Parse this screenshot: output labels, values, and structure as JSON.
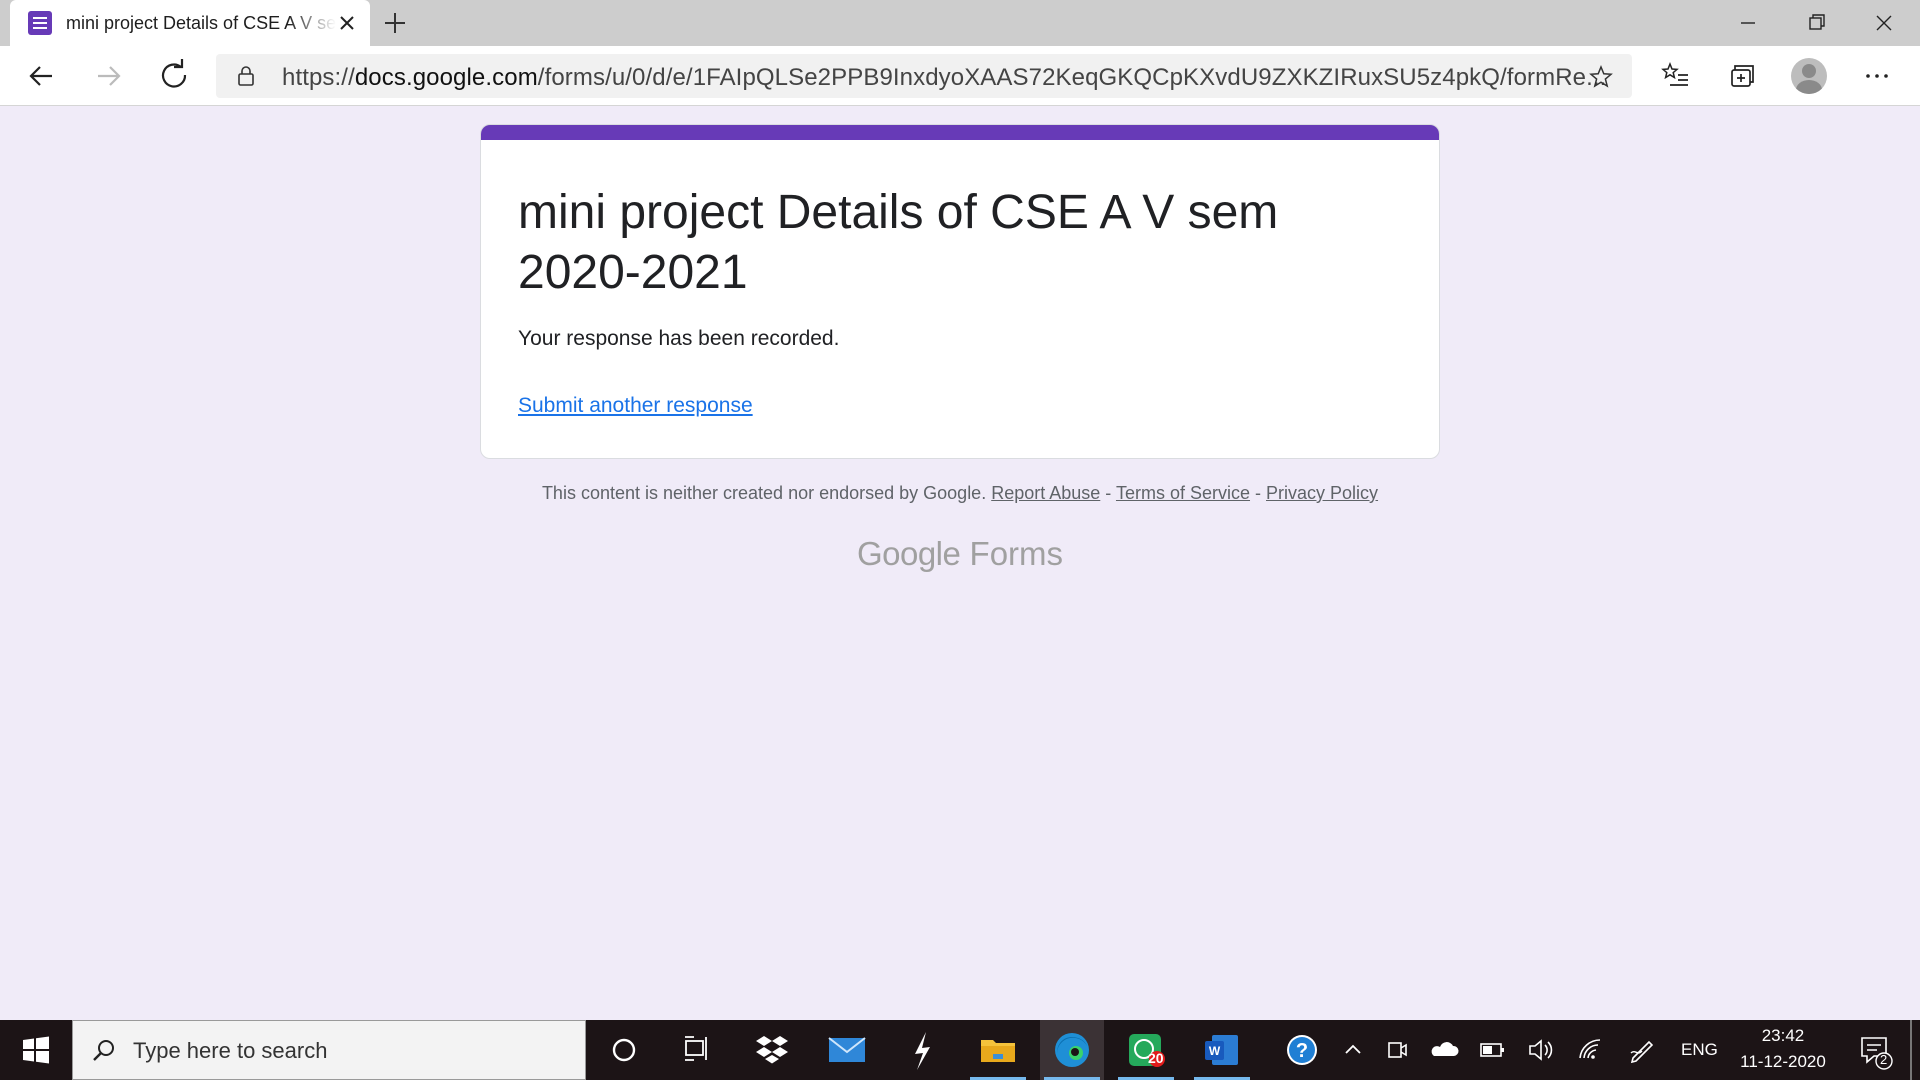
{
  "browser": {
    "tab_title": "mini project Details of CSE A V sem 2020-2021",
    "url_prefix": "https://",
    "url_host": "docs.google.com",
    "url_path": "/forms/u/0/d/e/1FAIpQLSe2PPB9InxdyoXAAS72KeqGKQCpKXvdU9ZXKZIRuxSU5z4pkQ/formRe..."
  },
  "form": {
    "title": "mini project Details of CSE A V sem 2020-2021",
    "confirmation": "Your response has been recorded.",
    "submit_another": "Submit another response",
    "accent_color": "#673ab7"
  },
  "footer": {
    "disclaimer": "This content is neither created nor endorsed by Google.",
    "report_abuse": "Report Abuse",
    "sep": " - ",
    "terms": "Terms of Service",
    "privacy": "Privacy Policy",
    "brand_google": "Google",
    "brand_forms": "Forms"
  },
  "taskbar": {
    "search_placeholder": "Type here to search",
    "whatsapp_badge": "20",
    "language": "ENG",
    "time": "23:42",
    "date": "11-12-2020",
    "notification_count": "2"
  }
}
